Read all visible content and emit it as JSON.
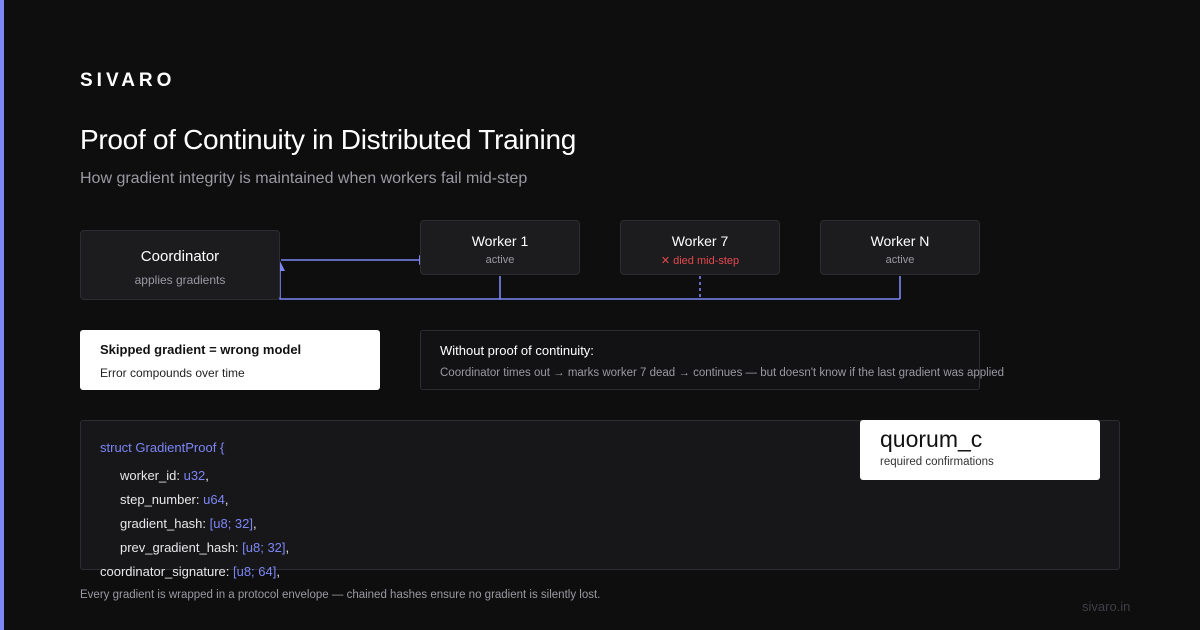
{
  "brand": "SIVARO",
  "title": "Proof of Continuity in Distributed Training",
  "subtitle": "How gradient integrity is maintained when workers fail mid-step",
  "diagram": {
    "coordinator": {
      "name": "Coordinator",
      "sub": "applies gradients"
    },
    "workers": [
      {
        "name": "Worker 1",
        "status": "active"
      },
      {
        "name": "Worker 7",
        "status": "✕ died mid-step"
      },
      {
        "name": "Worker N",
        "status": "active"
      }
    ]
  },
  "callouts": {
    "warning": {
      "heading": "Skipped gradient = wrong model",
      "body": "Error compounds over time"
    },
    "without": {
      "heading": "Without proof of continuity:",
      "body": "Coordinator times out → marks worker 7 dead → continues — but doesn't know if the last gradient was applied"
    }
  },
  "code": {
    "header": "struct GradientProof {",
    "fields": [
      {
        "name": "worker_id:",
        "type": "u32",
        "sep": ","
      },
      {
        "name": "step_number:",
        "type": "u64",
        "sep": ","
      },
      {
        "name": "gradient_hash:",
        "type": "[u8; 32]",
        "sep": ","
      },
      {
        "name": "prev_gradient_hash:",
        "type": "[u8; 32]",
        "sep": ","
      },
      {
        "name": "coordinator_signature:",
        "type": "[u8; 64]",
        "sep": ","
      }
    ]
  },
  "quorum": {
    "name": "quorum_c",
    "desc": "required confirmations"
  },
  "caption": "Every gradient is wrapped in a protocol envelope — chained hashes ensure no gradient is silently lost.",
  "footer": "sivaro.in",
  "colors": {
    "accent": "#7c86f5",
    "error": "#e5484d",
    "background": "#0e0e0f"
  }
}
